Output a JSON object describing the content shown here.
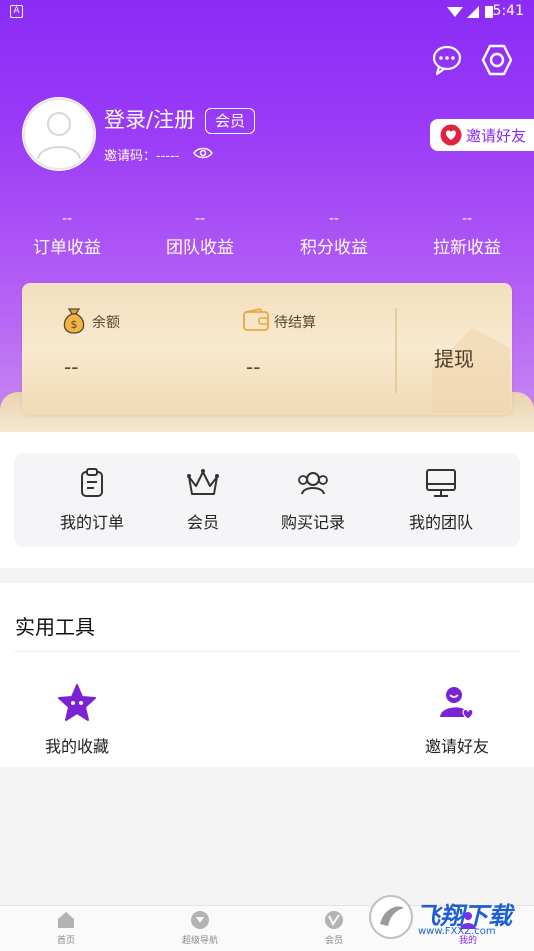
{
  "status_bar": {
    "badge": "A",
    "time": "5:41"
  },
  "header": {
    "login_label": "登录/注册",
    "vip_tag": "会员",
    "invite_code": "邀请码：-----",
    "invite_friend_button": "邀请好友"
  },
  "stats": [
    {
      "value": "--",
      "label": "订单收益"
    },
    {
      "value": "--",
      "label": "团队收益"
    },
    {
      "value": "--",
      "label": "积分收益"
    },
    {
      "value": "--",
      "label": "拉新收益"
    }
  ],
  "wallet": {
    "balance_label": "余额",
    "balance_value": "--",
    "pending_label": "待结算",
    "pending_value": "--",
    "withdraw_label": "提现"
  },
  "quick_menu": [
    {
      "label": "我的订单",
      "icon": "clipboard-icon"
    },
    {
      "label": "会员",
      "icon": "crown-icon"
    },
    {
      "label": "购买记录",
      "icon": "users-icon"
    },
    {
      "label": "我的团队",
      "icon": "monitor-icon"
    }
  ],
  "tools": {
    "title": "实用工具",
    "items": [
      {
        "label": "我的收藏",
        "icon": "star-icon"
      },
      {
        "label": "邀请好友",
        "icon": "user-heart-icon"
      }
    ]
  },
  "bottom_nav": [
    {
      "label": "首页",
      "icon": "home-icon"
    },
    {
      "label": "超级导航",
      "icon": "compass-icon"
    },
    {
      "label": "会员",
      "icon": "vip-icon"
    },
    {
      "label": "我的",
      "icon": "person-icon",
      "active": true
    }
  ],
  "watermark": {
    "title": "飞翔下载",
    "url": "www.FXXZ.com"
  },
  "colors": {
    "accent": "#8a2cf6",
    "gold_card": "#f3dfbf",
    "tool_icon": "#7b22d6"
  }
}
